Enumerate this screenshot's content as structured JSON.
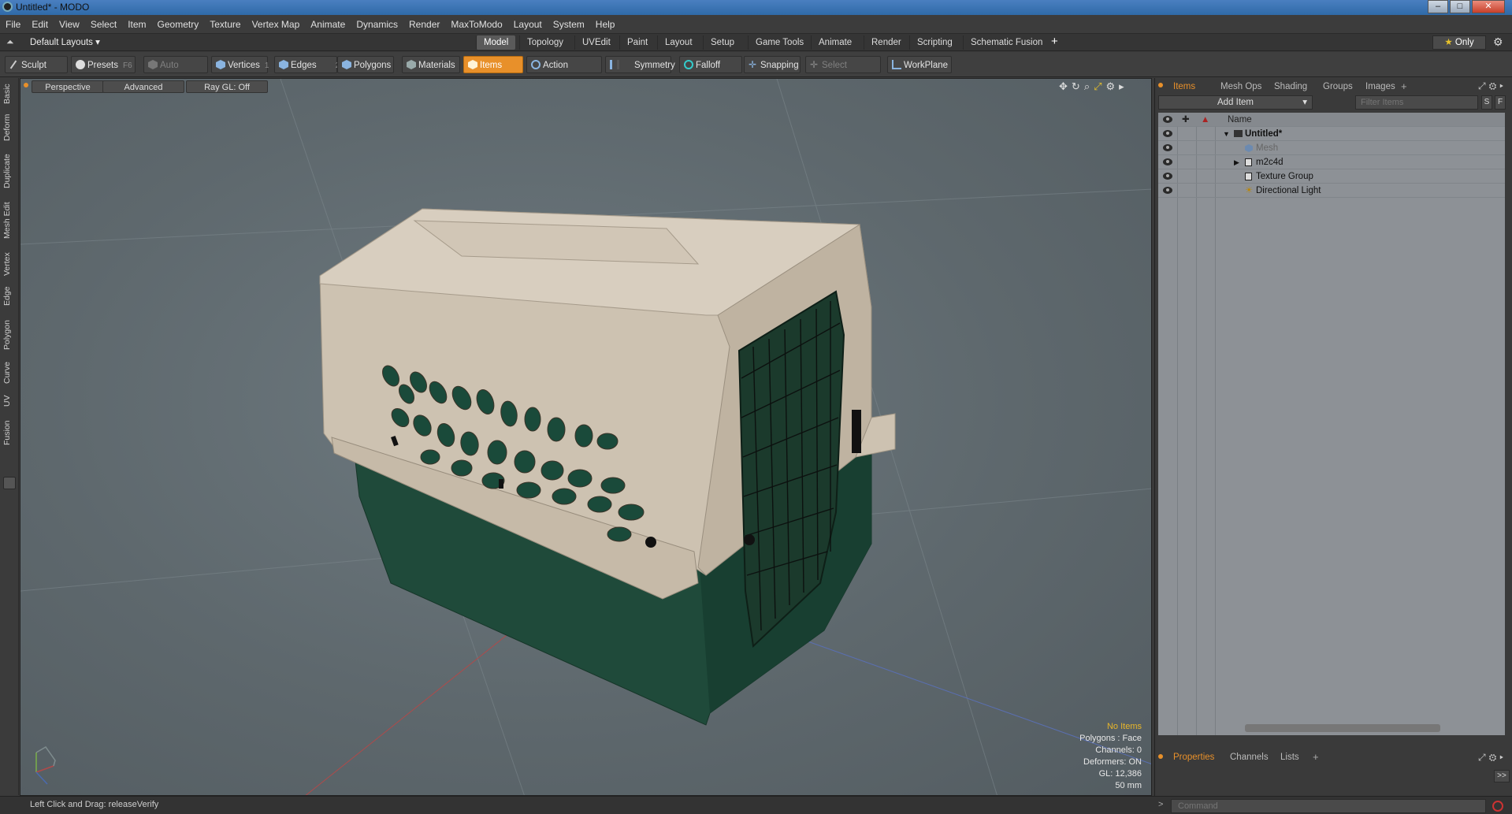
{
  "window": {
    "title": "Untitled* - MODO"
  },
  "menu": [
    "File",
    "Edit",
    "View",
    "Select",
    "Item",
    "Geometry",
    "Texture",
    "Vertex Map",
    "Animate",
    "Dynamics",
    "Render",
    "MaxToModo",
    "Layout",
    "System",
    "Help"
  ],
  "layout_bar": {
    "layouts_label": "Default Layouts",
    "tabs": [
      "Model",
      "Topology",
      "UVEdit",
      "Paint",
      "Layout",
      "Setup",
      "Game Tools",
      "Animate",
      "Render",
      "Scripting",
      "Schematic Fusion"
    ],
    "active_tab": "Model",
    "add_label": "+",
    "only_label": "Only"
  },
  "toolbar": {
    "sculpt": "Sculpt",
    "presets": "Presets",
    "presets_key": "F6",
    "auto_select": "Auto Select",
    "vertices": "Vertices",
    "vertices_key": "1",
    "edges": "Edges",
    "edges_key": "2",
    "polygons": "Polygons",
    "materials": "Materials",
    "items": "Items",
    "action_center": "Action Center",
    "symmetry": "Symmetry",
    "falloff": "Falloff",
    "snapping": "Snapping",
    "select_through": "Select Through",
    "workplane": "WorkPlane"
  },
  "left_tabs": [
    "Basic",
    "Deform",
    "Duplicate",
    "Mesh Edit",
    "Vertex",
    "Edge",
    "Polygon",
    "Curve",
    "UV",
    "Fusion"
  ],
  "viewport": {
    "view_mode": "Perspective",
    "shading": "Advanced",
    "raygl": "Ray GL: Off",
    "info": {
      "selection": "No Items",
      "polygons": "Polygons : Face",
      "channels": "Channels: 0",
      "deformers": "Deformers: ON",
      "gl": "GL: 12,386",
      "scale": "50 mm"
    }
  },
  "right_panel": {
    "tabs": [
      "Items",
      "Mesh Ops",
      "Shading",
      "Groups",
      "Images"
    ],
    "active_tab": "Items",
    "add_item": "Add Item",
    "filter_placeholder": "Filter Items",
    "filter_s": "S",
    "filter_f": "F",
    "name_header": "Name",
    "items": [
      {
        "label": "Untitled*",
        "bold": true
      },
      {
        "label": "Mesh",
        "dim": true
      },
      {
        "label": "m2c4d"
      },
      {
        "label": "Texture Group"
      },
      {
        "label": "Directional Light"
      }
    ],
    "bottom_tabs": [
      "Properties",
      "Channels",
      "Lists"
    ],
    "bottom_active": "Properties"
  },
  "status": {
    "hint": "Left Click and Drag:  releaseVerify",
    "command_placeholder": "Command",
    "command_prompt": ">"
  },
  "colors": {
    "accent": "#e8902a",
    "crate_top": "#cbbfae",
    "crate_bottom": "#1f4a3a"
  }
}
